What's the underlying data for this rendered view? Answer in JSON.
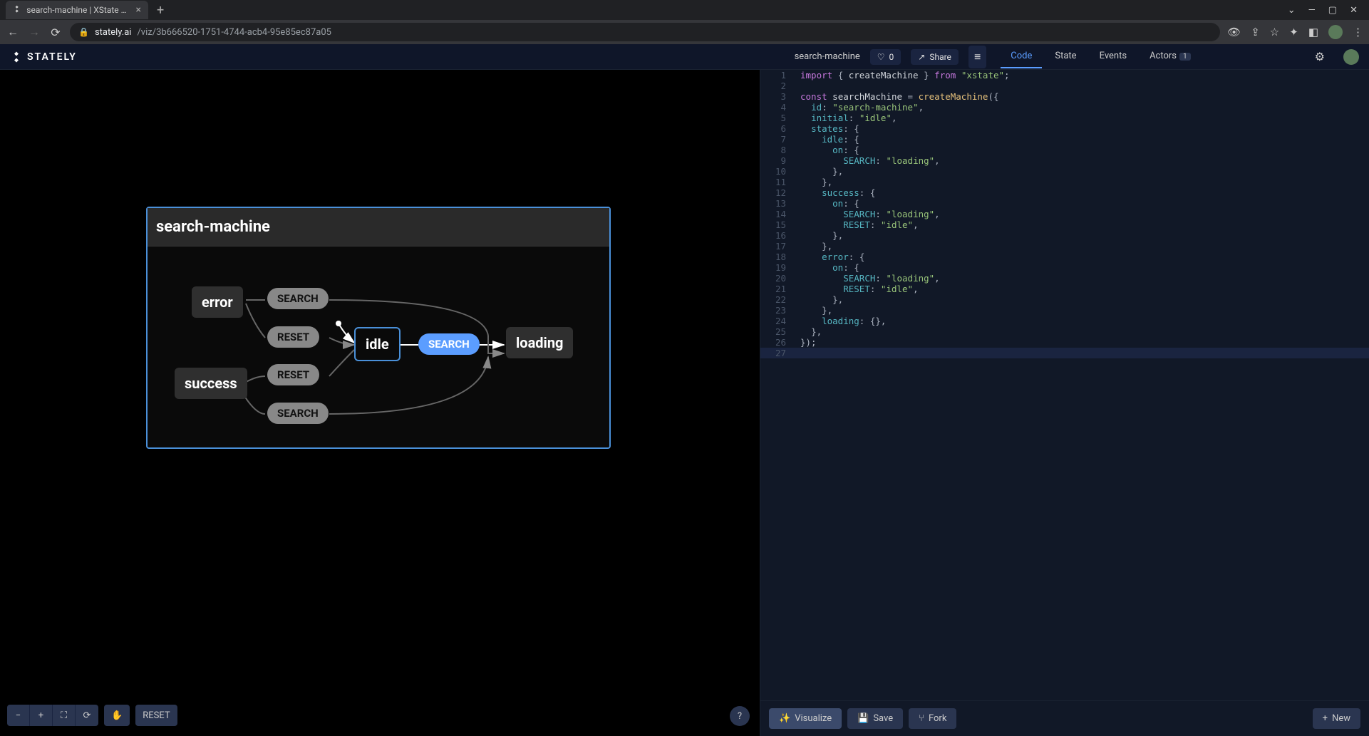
{
  "browser": {
    "tab_title": "search-machine | XState Visualize",
    "url_domain": "stately.ai",
    "url_path": "/viz/3b666520-1751-4744-acb4-95e85ec87a05"
  },
  "header": {
    "logo_text": "STATELY",
    "machine_name": "search-machine",
    "likes": "0",
    "share_label": "Share",
    "tabs": [
      {
        "label": "Code"
      },
      {
        "label": "State"
      },
      {
        "label": "Events"
      },
      {
        "label": "Actors",
        "badge": "1"
      }
    ]
  },
  "diagram": {
    "title": "search-machine",
    "states": {
      "error": "error",
      "success": "success",
      "idle": "idle",
      "loading": "loading"
    },
    "events": {
      "search1": "SEARCH",
      "reset1": "RESET",
      "reset2": "RESET",
      "search2": "SEARCH",
      "search3": "SEARCH"
    }
  },
  "code": {
    "lines": [
      {
        "n": 1,
        "html": "<span class='kw'>import</span> <span class='punc'>{</span> createMachine <span class='punc'>}</span> <span class='kw'>from</span> <span class='str'>\"xstate\"</span><span class='punc'>;</span>"
      },
      {
        "n": 2,
        "html": ""
      },
      {
        "n": 3,
        "html": "<span class='kw'>const</span> searchMachine <span class='punc'>=</span> <span class='fn'>createMachine</span><span class='punc'>({</span>"
      },
      {
        "n": 4,
        "html": "  <span class='prop'>id</span><span class='punc'>:</span> <span class='str'>\"search-machine\"</span><span class='punc'>,</span>"
      },
      {
        "n": 5,
        "html": "  <span class='prop'>initial</span><span class='punc'>:</span> <span class='str'>\"idle\"</span><span class='punc'>,</span>"
      },
      {
        "n": 6,
        "html": "  <span class='prop'>states</span><span class='punc'>:</span> <span class='punc'>{</span>"
      },
      {
        "n": 7,
        "html": "    <span class='prop'>idle</span><span class='punc'>:</span> <span class='punc'>{</span>"
      },
      {
        "n": 8,
        "html": "      <span class='prop'>on</span><span class='punc'>:</span> <span class='punc'>{</span>"
      },
      {
        "n": 9,
        "html": "        <span class='prop'>SEARCH</span><span class='punc'>:</span> <span class='str'>\"loading\"</span><span class='punc'>,</span>"
      },
      {
        "n": 10,
        "html": "      <span class='punc'>},</span>"
      },
      {
        "n": 11,
        "html": "    <span class='punc'>},</span>"
      },
      {
        "n": 12,
        "html": "    <span class='prop'>success</span><span class='punc'>:</span> <span class='punc'>{</span>"
      },
      {
        "n": 13,
        "html": "      <span class='prop'>on</span><span class='punc'>:</span> <span class='punc'>{</span>"
      },
      {
        "n": 14,
        "html": "        <span class='prop'>SEARCH</span><span class='punc'>:</span> <span class='str'>\"loading\"</span><span class='punc'>,</span>"
      },
      {
        "n": 15,
        "html": "        <span class='prop'>RESET</span><span class='punc'>:</span> <span class='str'>\"idle\"</span><span class='punc'>,</span>"
      },
      {
        "n": 16,
        "html": "      <span class='punc'>},</span>"
      },
      {
        "n": 17,
        "html": "    <span class='punc'>},</span>"
      },
      {
        "n": 18,
        "html": "    <span class='prop'>error</span><span class='punc'>:</span> <span class='punc'>{</span>"
      },
      {
        "n": 19,
        "html": "      <span class='prop'>on</span><span class='punc'>:</span> <span class='punc'>{</span>"
      },
      {
        "n": 20,
        "html": "        <span class='prop'>SEARCH</span><span class='punc'>:</span> <span class='str'>\"loading\"</span><span class='punc'>,</span>"
      },
      {
        "n": 21,
        "html": "        <span class='prop'>RESET</span><span class='punc'>:</span> <span class='str'>\"idle\"</span><span class='punc'>,</span>"
      },
      {
        "n": 22,
        "html": "      <span class='punc'>},</span>"
      },
      {
        "n": 23,
        "html": "    <span class='punc'>},</span>"
      },
      {
        "n": 24,
        "html": "    <span class='prop'>loading</span><span class='punc'>:</span> <span class='punc'>{},</span>"
      },
      {
        "n": 25,
        "html": "  <span class='punc'>},</span>"
      },
      {
        "n": 26,
        "html": "<span class='punc'>});</span>"
      },
      {
        "n": 27,
        "html": "",
        "hl": true
      }
    ]
  },
  "canvas_footer": {
    "reset": "RESET"
  },
  "code_footer": {
    "visualize": "Visualize",
    "save": "Save",
    "fork": "Fork",
    "new": "New"
  }
}
